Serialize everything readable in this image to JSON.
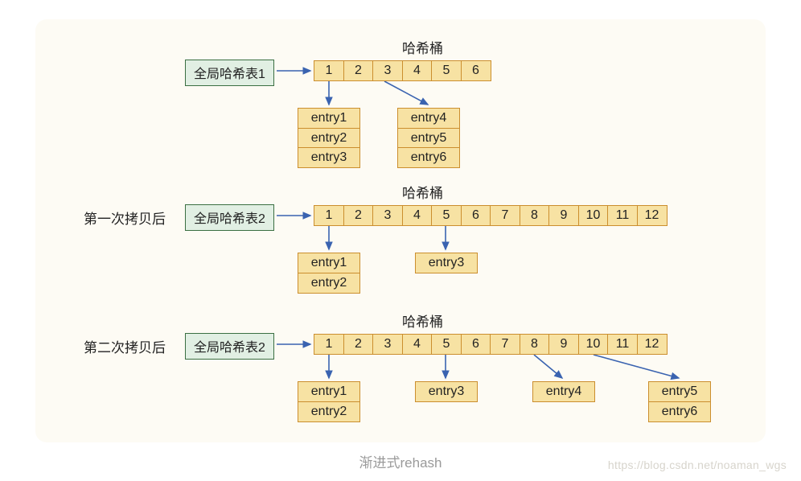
{
  "caption": "渐进式rehash",
  "watermark": "https://blog.csdn.net/noaman_wgs",
  "bucket_header": "哈希桶",
  "sections": [
    {
      "step_label": "",
      "table_label": "全局哈希表1",
      "cells": [
        "1",
        "2",
        "3",
        "4",
        "5",
        "6"
      ],
      "entry_groups": [
        {
          "entries": [
            "entry1",
            "entry2",
            "entry3"
          ]
        },
        {
          "entries": [
            "entry4",
            "entry5",
            "entry6"
          ]
        }
      ]
    },
    {
      "step_label": "第一次拷贝后",
      "table_label": "全局哈希表2",
      "cells": [
        "1",
        "2",
        "3",
        "4",
        "5",
        "6",
        "7",
        "8",
        "9",
        "10",
        "11",
        "12"
      ],
      "entry_groups": [
        {
          "entries": [
            "entry1",
            "entry2"
          ]
        },
        {
          "entries": [
            "entry3"
          ]
        }
      ]
    },
    {
      "step_label": "第二次拷贝后",
      "table_label": "全局哈希表2",
      "cells": [
        "1",
        "2",
        "3",
        "4",
        "5",
        "6",
        "7",
        "8",
        "9",
        "10",
        "11",
        "12"
      ],
      "entry_groups": [
        {
          "entries": [
            "entry1",
            "entry2"
          ]
        },
        {
          "entries": [
            "entry3"
          ]
        },
        {
          "entries": [
            "entry4"
          ]
        },
        {
          "entries": [
            "entry5",
            "entry6"
          ]
        }
      ]
    }
  ]
}
